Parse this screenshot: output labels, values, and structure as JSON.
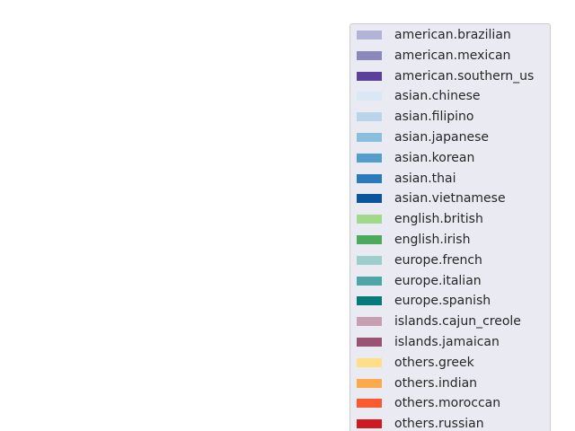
{
  "chart_data": {
    "type": "area",
    "title": "",
    "xlabel": "",
    "ylabel": "",
    "grid": true,
    "legend_placement": "right",
    "series": [
      {
        "name": "american.brazilian",
        "color": "#b3b3d8"
      },
      {
        "name": "american.mexican",
        "color": "#8b88c0"
      },
      {
        "name": "american.southern_us",
        "color": "#5b3f9b"
      },
      {
        "name": "asian.chinese",
        "color": "#dae8f5"
      },
      {
        "name": "asian.filipino",
        "color": "#b9d5ec"
      },
      {
        "name": "asian.japanese",
        "color": "#89bedc"
      },
      {
        "name": "asian.korean",
        "color": "#539ecd"
      },
      {
        "name": "asian.thai",
        "color": "#2b7bba"
      },
      {
        "name": "asian.vietnamese",
        "color": "#0b559f"
      },
      {
        "name": "english.british",
        "color": "#a1d98b"
      },
      {
        "name": "english.irish",
        "color": "#4bab5a"
      },
      {
        "name": "europe.french",
        "color": "#9ccfcc"
      },
      {
        "name": "europe.italian",
        "color": "#4ea5a5"
      },
      {
        "name": "europe.spanish",
        "color": "#067a78"
      },
      {
        "name": "islands.cajun_creole",
        "color": "#c79fb0"
      },
      {
        "name": "islands.jamaican",
        "color": "#9a5373"
      },
      {
        "name": "others.greek",
        "color": "#fedf88"
      },
      {
        "name": "others.indian",
        "color": "#fcaa4b"
      },
      {
        "name": "others.moroccan",
        "color": "#fb5930"
      },
      {
        "name": "others.russian",
        "color": "#d01a20"
      }
    ]
  }
}
